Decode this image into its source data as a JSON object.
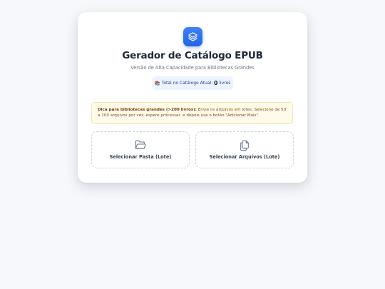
{
  "header": {
    "logo_icon": "layers-icon",
    "title": "Gerador de Catálogo EPUB",
    "subtitle": "Versão de Alta Capacidade para Bibliotecas Grandes"
  },
  "catalog_count": {
    "icon": "books-emoji",
    "label": "Total no Catálogo Atual:",
    "value": "0",
    "unit": "livros"
  },
  "tip": {
    "bold": "Dica para bibliotecas grandes (>200 livros):",
    "text": " Envie os arquivos em lotes. Selecione de 50 a 100 arquivos por vez, espere processar, e depois use o botão \"Adicionar Mais\"."
  },
  "actions": {
    "select_folder": {
      "label": "Selecionar Pasta (Lote)",
      "icon": "folder-open-icon"
    },
    "select_files": {
      "label": "Selecionar Arquivos (Lote)",
      "icon": "files-icon"
    }
  },
  "colors": {
    "accent": "#2563eb",
    "tip_bg": "#fffbea",
    "tip_text": "#92400e",
    "badge_bg": "#eef4ff"
  }
}
